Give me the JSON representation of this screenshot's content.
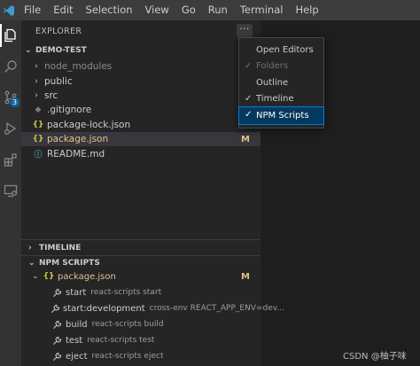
{
  "menubar": {
    "items": [
      "File",
      "Edit",
      "Selection",
      "View",
      "Go",
      "Run",
      "Terminal",
      "Help"
    ]
  },
  "activitybar": {
    "icons": [
      "files-icon",
      "search-icon",
      "source-control-icon",
      "run-debug-icon",
      "extensions-icon",
      "remote-explorer-icon"
    ],
    "scm_badge": "3"
  },
  "explorer": {
    "header": "EXPLORER",
    "more_label": "···",
    "folder": "DEMO-TEST",
    "tree": [
      {
        "label": "node_modules",
        "type": "folder"
      },
      {
        "label": "public",
        "type": "folder"
      },
      {
        "label": "src",
        "type": "folder"
      },
      {
        "label": ".gitignore",
        "type": "file",
        "icon": "git-icon"
      },
      {
        "label": "package-lock.json",
        "type": "file",
        "icon": "json-icon"
      },
      {
        "label": "package.json",
        "type": "file",
        "icon": "json-icon",
        "flag": "M"
      },
      {
        "label": "README.md",
        "type": "file",
        "icon": "info-icon"
      }
    ]
  },
  "timeline": {
    "title": "TIMELINE"
  },
  "npm_scripts": {
    "title": "NPM SCRIPTS",
    "package": "package.json",
    "package_flag": "M",
    "scripts": [
      {
        "name": "start",
        "command": "react-scripts start"
      },
      {
        "name": "start:development",
        "command": "cross-env REACT_APP_ENV=dev..."
      },
      {
        "name": "build",
        "command": "react-scripts build"
      },
      {
        "name": "test",
        "command": "react-scripts test"
      },
      {
        "name": "eject",
        "command": "react-scripts eject"
      }
    ]
  },
  "dropdown": {
    "items": [
      {
        "label": "Open Editors",
        "checked": false,
        "disabled": false
      },
      {
        "label": "Folders",
        "checked": true,
        "disabled": true
      },
      {
        "label": "Outline",
        "checked": false,
        "disabled": false
      },
      {
        "label": "Timeline",
        "checked": true,
        "disabled": false
      },
      {
        "label": "NPM Scripts",
        "checked": true,
        "disabled": false
      }
    ],
    "check_glyph": "✓"
  },
  "watermark": "CSDN @柚子味",
  "colors": {
    "accent": "#007fd4",
    "modified": "#e2c08d",
    "badge": "#0e639c"
  }
}
